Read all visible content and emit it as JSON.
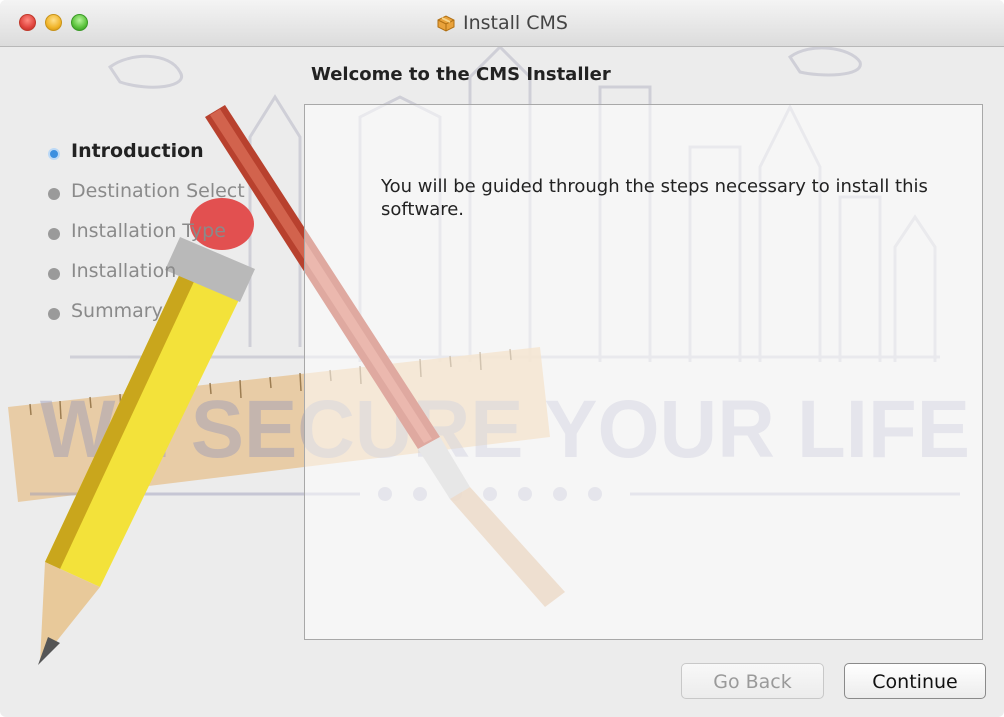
{
  "window": {
    "title": "Install CMS",
    "title_icon": "package-icon"
  },
  "main": {
    "heading": "Welcome to the CMS Installer",
    "body": "You will be guided through the steps necessary to install this software."
  },
  "sidebar": {
    "steps": [
      {
        "label": "Introduction",
        "active": true
      },
      {
        "label": "Destination Select",
        "active": false
      },
      {
        "label": "Installation Type",
        "active": false
      },
      {
        "label": "Installation",
        "active": false
      },
      {
        "label": "Summary",
        "active": false
      }
    ]
  },
  "watermark": {
    "text": "WE SECURE YOUR LIFE"
  },
  "buttons": {
    "go_back": "Go Back",
    "continue": "Continue"
  },
  "colors": {
    "active_step": "#3b8fe0",
    "inactive_step": "#9a9a9a",
    "window_bg": "#ececec"
  }
}
